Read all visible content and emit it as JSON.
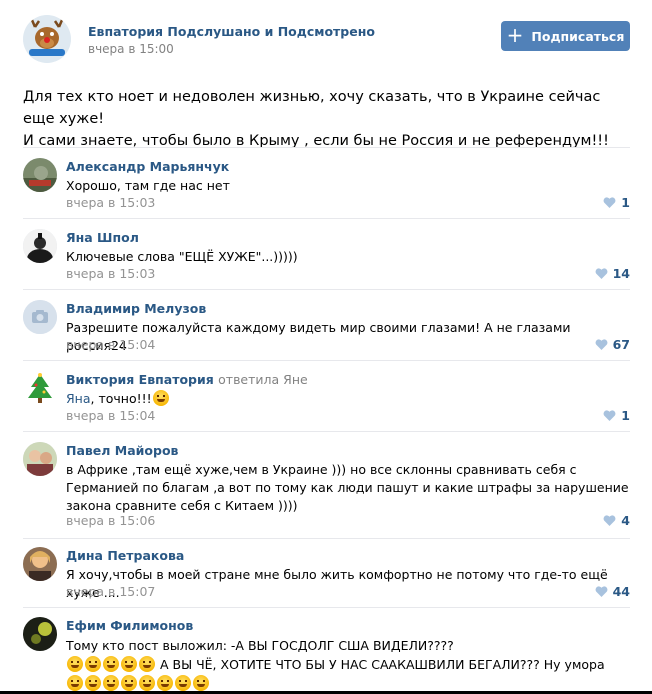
{
  "post": {
    "group_name": "Евпатория Подслушано и Подсмотрено",
    "time": "вчера в 15:00",
    "subscribe_label": "Подписаться",
    "text_line1": "Для тех кто ноет и недоволен жизнью, хочу сказать, что в Украине сейчас еще хуже!",
    "text_line2": "И сами знаете, чтобы было в Крыму , если бы не Россия и не референдум!!!"
  },
  "comments": [
    {
      "author": "Александр Марьянчук",
      "text": "Хорошо, там где нас нет",
      "time": "вчера в 15:03",
      "likes": "1"
    },
    {
      "author": "Яна Шпол",
      "text": "Ключевые слова \"ЕЩЁ ХУЖЕ\"...)))))",
      "time": "вчера в 15:03",
      "likes": "14"
    },
    {
      "author": "Владимир Мелузов",
      "text": "Разрешите пожалуйста каждому видеть мир своими глазами! А не глазами россия24",
      "time": "вчера в 15:04",
      "likes": "67"
    },
    {
      "author": "Виктория Евпатория",
      "reply": "ответила Яне",
      "mention": "Яна",
      "text": ", точно!!!",
      "time": "вчера в 15:04",
      "likes": "1"
    },
    {
      "author": "Павел Майоров",
      "text": "в Африке ,там ещё хуже,чем в Украине ))) но все склонны сравнивать себя с Германией по благам ,а вот по тому как люди пашут и какие штрафы за нарушение закона сравните себя с Китаем ))))",
      "time": "вчера в 15:06",
      "likes": "4"
    },
    {
      "author": "Дина Петракова",
      "text": "Я хочу,чтобы в моей стране мне было жить комфортно не потому что где-то ещё хуже ....",
      "time": "вчера в 15:07",
      "likes": "44"
    },
    {
      "author": "Ефим Филимонов",
      "text_line1": "Тому кто пост выложил: -А ВЫ ГОСДОЛГ США ВИДЕЛИ????",
      "text_line2": "А ВЫ ЧЁ, ХОТИТЕ ЧТО БЫ У НАС СААКАШВИЛИ БЕГАЛИ??? Ну умора"
    }
  ],
  "colors": {
    "link": "#2a5885",
    "button": "#5181b8",
    "meta": "#939393",
    "divider": "#e7e8ec"
  },
  "icons": {
    "like": "heart-icon",
    "subscribe": "plus-icon",
    "no_photo": "camera-icon",
    "emoji": "laughing-face-emoji"
  }
}
